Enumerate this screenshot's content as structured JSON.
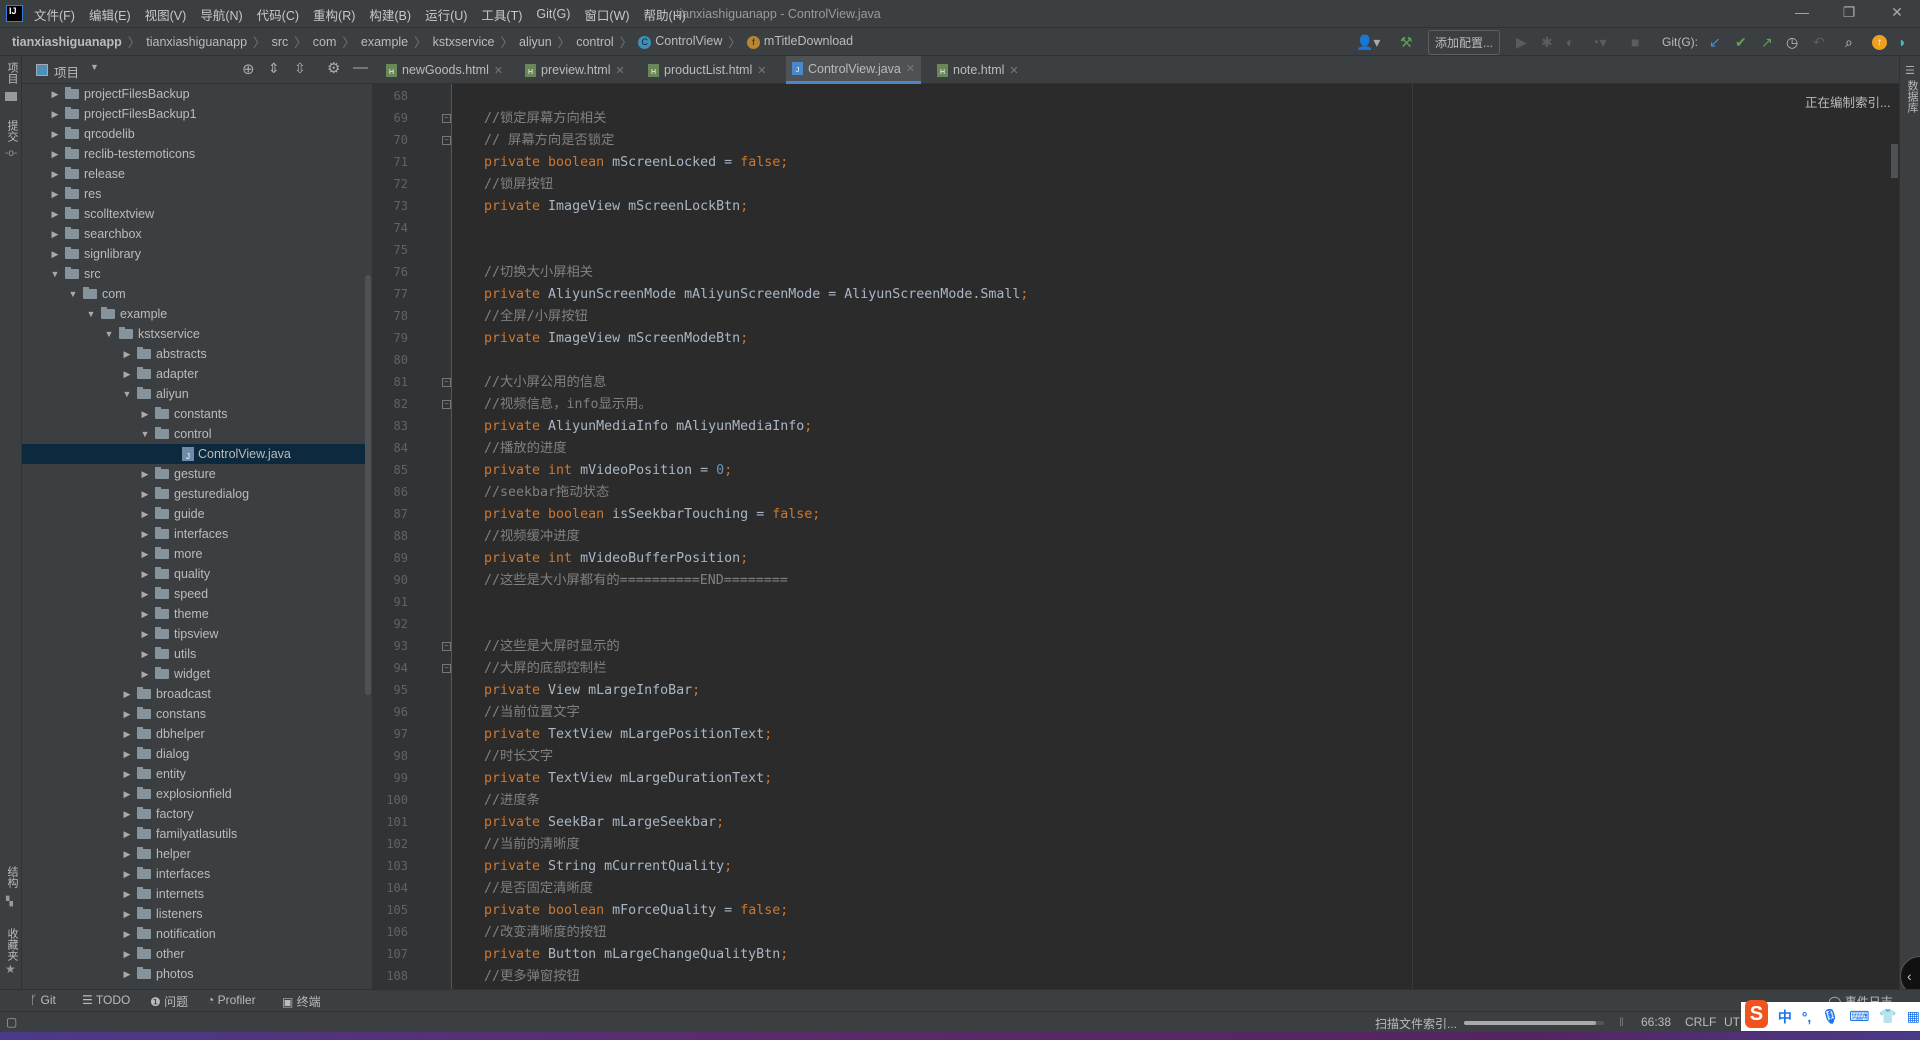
{
  "titlebar": {
    "logo": "IJ",
    "menu": [
      "文件(F)",
      "编辑(E)",
      "视图(V)",
      "导航(N)",
      "代码(C)",
      "重构(R)",
      "构建(B)",
      "运行(U)",
      "工具(T)",
      "Git(G)",
      "窗口(W)",
      "帮助(H)"
    ],
    "window_title": "tianxiashiguanapp - ControlView.java",
    "minimize": "—",
    "restore": "❐",
    "close": "✕"
  },
  "breadcrumbs": [
    "tianxiashiguanapp",
    "tianxiashiguanapp",
    "src",
    "com",
    "example",
    "kstxservice",
    "aliyun",
    "control"
  ],
  "breadcrumb_class": {
    "badge": "C",
    "label": "ControlView",
    "color": "#3d8fb8"
  },
  "breadcrumb_field": {
    "badge": "f",
    "label": "mTitleDownload",
    "color": "#b8862f"
  },
  "toolbar": {
    "add_config": "添加配置...",
    "git_label": "Git(G):"
  },
  "left_strip": [
    "项目",
    "提交",
    "结构",
    "收藏夹"
  ],
  "right_strip": [
    "数据库"
  ],
  "project_panel": {
    "title": "项目"
  },
  "tree": [
    {
      "label": "projectFilesBackup",
      "depth": 0,
      "state": "collapsed"
    },
    {
      "label": "projectFilesBackup1",
      "depth": 0,
      "state": "collapsed"
    },
    {
      "label": "qrcodelib",
      "depth": 0,
      "state": "collapsed"
    },
    {
      "label": "reclib-testemoticons",
      "depth": 0,
      "state": "collapsed"
    },
    {
      "label": "release",
      "depth": 0,
      "state": "collapsed"
    },
    {
      "label": "res",
      "depth": 0,
      "state": "collapsed"
    },
    {
      "label": "scolltextview",
      "depth": 0,
      "state": "collapsed"
    },
    {
      "label": "searchbox",
      "depth": 0,
      "state": "collapsed"
    },
    {
      "label": "signlibrary",
      "depth": 0,
      "state": "collapsed"
    },
    {
      "label": "src",
      "depth": 0,
      "state": "expanded"
    },
    {
      "label": "com",
      "depth": 1,
      "state": "expanded"
    },
    {
      "label": "example",
      "depth": 2,
      "state": "expanded"
    },
    {
      "label": "kstxservice",
      "depth": 3,
      "state": "expanded"
    },
    {
      "label": "abstracts",
      "depth": 4,
      "state": "collapsed"
    },
    {
      "label": "adapter",
      "depth": 4,
      "state": "collapsed"
    },
    {
      "label": "aliyun",
      "depth": 4,
      "state": "expanded"
    },
    {
      "label": "constants",
      "depth": 5,
      "state": "collapsed"
    },
    {
      "label": "control",
      "depth": 5,
      "state": "expanded"
    },
    {
      "label": "ControlView.java",
      "depth": 6,
      "state": "file",
      "selected": true
    },
    {
      "label": "gesture",
      "depth": 5,
      "state": "collapsed"
    },
    {
      "label": "gesturedialog",
      "depth": 5,
      "state": "collapsed"
    },
    {
      "label": "guide",
      "depth": 5,
      "state": "collapsed"
    },
    {
      "label": "interfaces",
      "depth": 5,
      "state": "collapsed"
    },
    {
      "label": "more",
      "depth": 5,
      "state": "collapsed"
    },
    {
      "label": "quality",
      "depth": 5,
      "state": "collapsed"
    },
    {
      "label": "speed",
      "depth": 5,
      "state": "collapsed"
    },
    {
      "label": "theme",
      "depth": 5,
      "state": "collapsed"
    },
    {
      "label": "tipsview",
      "depth": 5,
      "state": "collapsed"
    },
    {
      "label": "utils",
      "depth": 5,
      "state": "collapsed"
    },
    {
      "label": "widget",
      "depth": 5,
      "state": "collapsed"
    },
    {
      "label": "broadcast",
      "depth": 4,
      "state": "collapsed"
    },
    {
      "label": "constans",
      "depth": 4,
      "state": "collapsed"
    },
    {
      "label": "dbhelper",
      "depth": 4,
      "state": "collapsed"
    },
    {
      "label": "dialog",
      "depth": 4,
      "state": "collapsed"
    },
    {
      "label": "entity",
      "depth": 4,
      "state": "collapsed"
    },
    {
      "label": "explosionfield",
      "depth": 4,
      "state": "collapsed"
    },
    {
      "label": "factory",
      "depth": 4,
      "state": "collapsed"
    },
    {
      "label": "familyatlasutils",
      "depth": 4,
      "state": "collapsed"
    },
    {
      "label": "helper",
      "depth": 4,
      "state": "collapsed"
    },
    {
      "label": "interfaces",
      "depth": 4,
      "state": "collapsed"
    },
    {
      "label": "internets",
      "depth": 4,
      "state": "collapsed"
    },
    {
      "label": "listeners",
      "depth": 4,
      "state": "collapsed"
    },
    {
      "label": "notification",
      "depth": 4,
      "state": "collapsed"
    },
    {
      "label": "other",
      "depth": 4,
      "state": "collapsed"
    },
    {
      "label": "photos",
      "depth": 4,
      "state": "collapsed"
    }
  ],
  "tabs": [
    {
      "label": "newGoods.html",
      "type": "html"
    },
    {
      "label": "preview.html",
      "type": "html"
    },
    {
      "label": "productList.html",
      "type": "html"
    },
    {
      "label": "ControlView.java",
      "type": "java",
      "active": true
    },
    {
      "label": "note.html",
      "type": "html"
    }
  ],
  "editor": {
    "indexing": "正在编制索引...",
    "fold_lines": [
      69,
      70,
      81,
      82,
      93,
      94
    ],
    "lines": [
      {
        "n": "68",
        "tokens": []
      },
      {
        "n": "69",
        "tokens": [
          [
            "c",
            "//锁定屏幕方向相关"
          ]
        ]
      },
      {
        "n": "70",
        "tokens": [
          [
            "c",
            "// 屏幕方向是否锁定"
          ]
        ]
      },
      {
        "n": "71",
        "tokens": [
          [
            "k",
            "private boolean "
          ],
          [
            "p",
            "mScreenLocked = "
          ],
          [
            "k",
            "false"
          ],
          [
            "s",
            ";"
          ]
        ]
      },
      {
        "n": "72",
        "tokens": [
          [
            "c",
            "//锁屏按钮"
          ]
        ]
      },
      {
        "n": "73",
        "tokens": [
          [
            "k",
            "private "
          ],
          [
            "p",
            "ImageView mScreenLockBtn"
          ],
          [
            "s",
            ";"
          ]
        ]
      },
      {
        "n": "74",
        "tokens": []
      },
      {
        "n": "75",
        "tokens": []
      },
      {
        "n": "76",
        "tokens": [
          [
            "c",
            "//切换大小屏相关"
          ]
        ]
      },
      {
        "n": "77",
        "tokens": [
          [
            "k",
            "private "
          ],
          [
            "p",
            "AliyunScreenMode mAliyunScreenMode = AliyunScreenMode.Small"
          ],
          [
            "s",
            ";"
          ]
        ]
      },
      {
        "n": "78",
        "tokens": [
          [
            "c",
            "//全屏/小屏按钮"
          ]
        ]
      },
      {
        "n": "79",
        "tokens": [
          [
            "k",
            "private "
          ],
          [
            "p",
            "ImageView mScreenModeBtn"
          ],
          [
            "s",
            ";"
          ]
        ]
      },
      {
        "n": "80",
        "tokens": []
      },
      {
        "n": "81",
        "tokens": [
          [
            "c",
            "//大小屏公用的信息"
          ]
        ]
      },
      {
        "n": "82",
        "tokens": [
          [
            "c",
            "//视频信息，info显示用。"
          ]
        ]
      },
      {
        "n": "83",
        "tokens": [
          [
            "k",
            "private "
          ],
          [
            "p",
            "AliyunMediaInfo mAliyunMediaInfo"
          ],
          [
            "s",
            ";"
          ]
        ]
      },
      {
        "n": "84",
        "tokens": [
          [
            "c",
            "//播放的进度"
          ]
        ]
      },
      {
        "n": "85",
        "tokens": [
          [
            "k",
            "private int "
          ],
          [
            "p",
            "mVideoPosition = "
          ],
          [
            "n",
            "0"
          ],
          [
            "s",
            ";"
          ]
        ]
      },
      {
        "n": "86",
        "tokens": [
          [
            "c",
            "//seekbar拖动状态"
          ]
        ]
      },
      {
        "n": "87",
        "tokens": [
          [
            "k",
            "private boolean "
          ],
          [
            "p",
            "isSeekbarTouching = "
          ],
          [
            "k",
            "false"
          ],
          [
            "s",
            ";"
          ]
        ]
      },
      {
        "n": "88",
        "tokens": [
          [
            "c",
            "//视频缓冲进度"
          ]
        ]
      },
      {
        "n": "89",
        "tokens": [
          [
            "k",
            "private int "
          ],
          [
            "p",
            "mVideoBufferPosition"
          ],
          [
            "s",
            ";"
          ]
        ]
      },
      {
        "n": "90",
        "tokens": [
          [
            "c",
            "//这些是大小屏都有的==========END========"
          ]
        ]
      },
      {
        "n": "91",
        "tokens": []
      },
      {
        "n": "92",
        "tokens": []
      },
      {
        "n": "93",
        "tokens": [
          [
            "c",
            "//这些是大屏时显示的"
          ]
        ]
      },
      {
        "n": "94",
        "tokens": [
          [
            "c",
            "//大屏的底部控制栏"
          ]
        ]
      },
      {
        "n": "95",
        "tokens": [
          [
            "k",
            "private "
          ],
          [
            "p",
            "View mLargeInfoBar"
          ],
          [
            "s",
            ";"
          ]
        ]
      },
      {
        "n": "96",
        "tokens": [
          [
            "c",
            "//当前位置文字"
          ]
        ]
      },
      {
        "n": "97",
        "tokens": [
          [
            "k",
            "private "
          ],
          [
            "p",
            "TextView mLargePositionText"
          ],
          [
            "s",
            ";"
          ]
        ]
      },
      {
        "n": "98",
        "tokens": [
          [
            "c",
            "//时长文字"
          ]
        ]
      },
      {
        "n": "99",
        "tokens": [
          [
            "k",
            "private "
          ],
          [
            "p",
            "TextView mLargeDurationText"
          ],
          [
            "s",
            ";"
          ]
        ]
      },
      {
        "n": "100",
        "tokens": [
          [
            "c",
            "//进度条"
          ]
        ]
      },
      {
        "n": "101",
        "tokens": [
          [
            "k",
            "private "
          ],
          [
            "p",
            "SeekBar mLargeSeekbar"
          ],
          [
            "s",
            ";"
          ]
        ]
      },
      {
        "n": "102",
        "tokens": [
          [
            "c",
            "//当前的清晰度"
          ]
        ]
      },
      {
        "n": "103",
        "tokens": [
          [
            "k",
            "private "
          ],
          [
            "p",
            "String mCurrentQuality"
          ],
          [
            "s",
            ";"
          ]
        ]
      },
      {
        "n": "104",
        "tokens": [
          [
            "c",
            "//是否固定清晰度"
          ]
        ]
      },
      {
        "n": "105",
        "tokens": [
          [
            "k",
            "private boolean "
          ],
          [
            "p",
            "mForceQuality = "
          ],
          [
            "k",
            "false"
          ],
          [
            "s",
            ";"
          ]
        ]
      },
      {
        "n": "106",
        "tokens": [
          [
            "c",
            "//改变清晰度的按钮"
          ]
        ]
      },
      {
        "n": "107",
        "tokens": [
          [
            "k",
            "private "
          ],
          [
            "p",
            "Button mLargeChangeQualityBtn"
          ],
          [
            "s",
            ";"
          ]
        ]
      },
      {
        "n": "108",
        "tokens": [
          [
            "c",
            "//更多弹窗按钮"
          ]
        ]
      }
    ]
  },
  "bottom_tools": [
    {
      "label": "Git",
      "icon": "git-branch-icon"
    },
    {
      "label": "TODO",
      "icon": "list-icon"
    },
    {
      "label": "问题",
      "icon": "problems-icon"
    },
    {
      "label": "Profiler",
      "icon": "profiler-icon"
    },
    {
      "label": "终端",
      "icon": "terminal-icon"
    }
  ],
  "event_log": "事件日志",
  "status": {
    "task": "扫描文件索引...",
    "progress_percent": 94,
    "position": "66:38",
    "line_sep": "CRLF",
    "encoding": "UTF"
  },
  "ime": {
    "logo": "S",
    "mode": "中",
    "punct": "°,"
  },
  "colors": {
    "keyword": "#cc7832",
    "comment": "#808080",
    "number": "#6897bb",
    "text": "#a9b7c6",
    "selection": "#0d293e",
    "accent": "#4a88c7"
  }
}
